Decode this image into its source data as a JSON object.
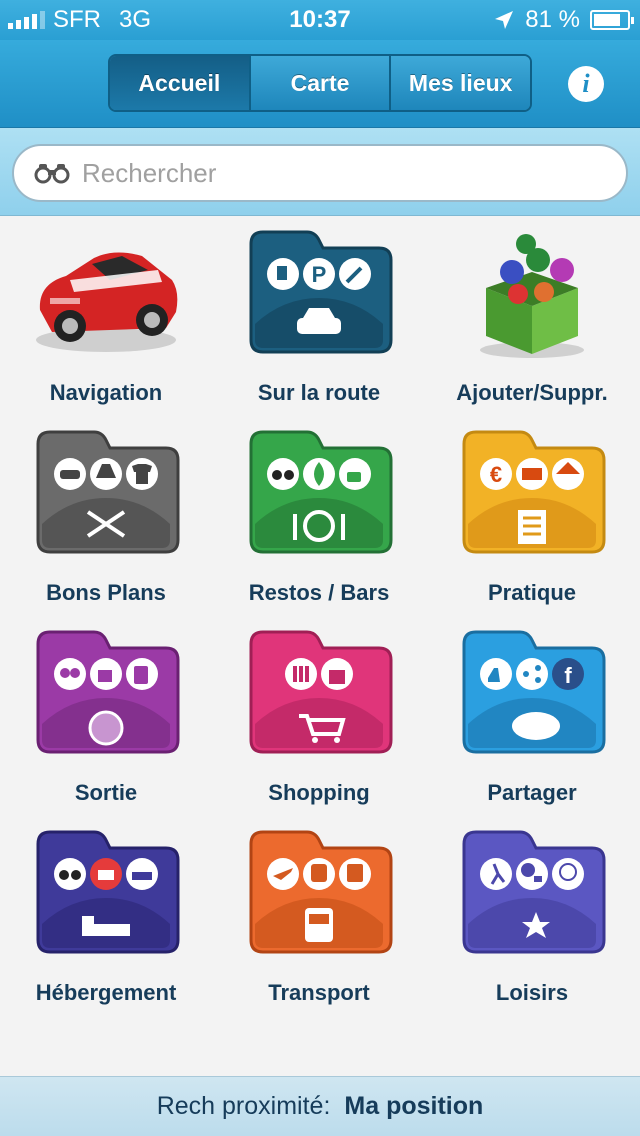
{
  "status": {
    "carrier": "SFR",
    "network": "3G",
    "time": "10:37",
    "battery": "81 %",
    "battery_level": 0.81
  },
  "nav": {
    "tabs": [
      "Accueil",
      "Carte",
      "Mes lieux"
    ],
    "active_tab": "Accueil",
    "info_icon": "i"
  },
  "search": {
    "placeholder": "Rechercher",
    "icon": "binoculars-icon"
  },
  "categories": [
    {
      "label": "Navigation",
      "icon": "sports-car-icon",
      "color": "#d63030"
    },
    {
      "label": "Sur la route",
      "icon": "road-folder-icon",
      "color": "#1c5f80"
    },
    {
      "label": "Ajouter/Suppr.",
      "icon": "green-box-icon",
      "color": "#5aa63a"
    },
    {
      "label": "Bons Plans",
      "icon": "bons-plans-folder-icon",
      "color": "#6b6b6b"
    },
    {
      "label": "Restos / Bars",
      "icon": "restos-folder-icon",
      "color": "#35a64a"
    },
    {
      "label": "Pratique",
      "icon": "pratique-folder-icon",
      "color": "#f2b226"
    },
    {
      "label": "Sortie",
      "icon": "sortie-folder-icon",
      "color": "#9b3aa6"
    },
    {
      "label": "Shopping",
      "icon": "shopping-folder-icon",
      "color": "#e0357a"
    },
    {
      "label": "Partager",
      "icon": "partager-folder-icon",
      "color": "#2b9fe0"
    },
    {
      "label": "Hébergement",
      "icon": "hebergement-folder-icon",
      "color": "#3f3a9a"
    },
    {
      "label": "Transport",
      "icon": "transport-folder-icon",
      "color": "#ec6a2e"
    },
    {
      "label": "Loisirs",
      "icon": "loisirs-folder-icon",
      "color": "#5b57c2"
    }
  ],
  "footer": {
    "label": "Rech proximité:",
    "value": "Ma position"
  }
}
